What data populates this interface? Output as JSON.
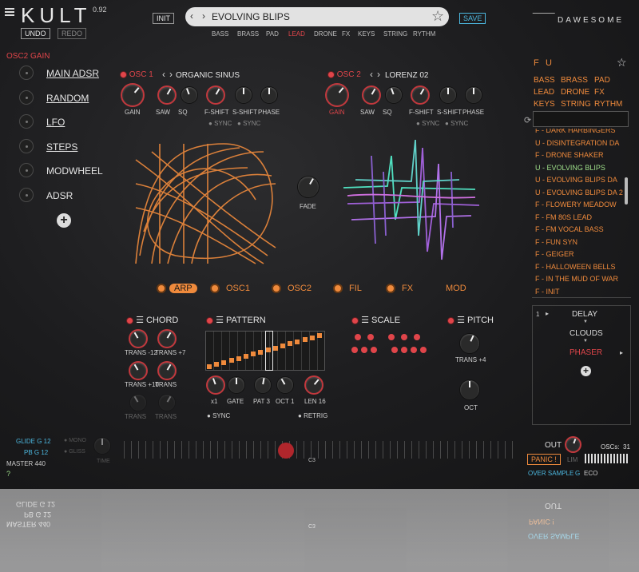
{
  "header": {
    "logo": "KULT",
    "version": "0.92",
    "undo": "UNDO",
    "redo": "REDO",
    "init": "INIT",
    "preset_name": "EVOLVING BLIPS",
    "save": "SAVE",
    "brand": "DAWESOME",
    "categories": [
      "BASS",
      "BRASS",
      "PAD",
      "LEAD",
      "DRONE",
      "FX",
      "KEYS",
      "STRING",
      "RYTHM"
    ],
    "active_category": "LEAD"
  },
  "left": {
    "heading": "OSC2 GAIN",
    "mod_sources": [
      "MAIN ADSR",
      "RANDOM",
      "LFO",
      "STEPS",
      "MODWHEEL",
      "ADSR"
    ]
  },
  "osc1": {
    "label": "OSC 1",
    "wave": "ORGANIC SINUS",
    "knobs": [
      "GAIN",
      "SAW",
      "SQ",
      "F-SHIFT",
      "S-SHIFT",
      "PHASE"
    ],
    "sync": "SYNC"
  },
  "osc2": {
    "label": "OSC 2",
    "wave": "LORENZ 02",
    "knobs": [
      "GAIN",
      "SAW",
      "SQ",
      "F-SHIFT",
      "S-SHIFT",
      "PHASE"
    ],
    "sync": "SYNC"
  },
  "fade_label": "FADE",
  "tabs": [
    "ARP",
    "OSC1",
    "OSC2",
    "FIL",
    "FX",
    "MOD"
  ],
  "active_tab": "ARP",
  "chord": {
    "title": "CHORD",
    "knobs": [
      "TRANS -12",
      "TRANS +7",
      "TRANS +10",
      "TRANS",
      "TRANS",
      "TRANS"
    ]
  },
  "pattern": {
    "title": "PATTERN",
    "knobs": [
      "x1",
      "GATE",
      "PAT 3",
      "OCT 1",
      "LEN 16"
    ],
    "sync": "SYNC",
    "retrig": "RETRIG"
  },
  "scale": {
    "title": "SCALE"
  },
  "pitch": {
    "title": "PITCH",
    "trans": "TRANS +4",
    "oct": "OCT"
  },
  "browser": {
    "filters": [
      "F",
      "U"
    ],
    "categories": [
      "BASS",
      "BRASS",
      "PAD",
      "LEAD",
      "DRONE",
      "FX",
      "KEYS",
      "STRING",
      "RYTHM"
    ],
    "presets": [
      "F - DARK HARBINGERS",
      "U - DISINTEGRATION DA",
      "F - DRONE SHAKER",
      "U - EVOLVING BLIPS",
      "U - EVOLVING BLIPS DA",
      "U - EVOLVING BLIPS DA 2",
      "F - FLOWERY MEADOW",
      "F - FM 80S LEAD",
      "F - FM VOCAL BASS",
      "F - FUN SYN",
      "F - GEIGER",
      "F - HALLOWEEN BELLS",
      "F - IN THE MUD OF WAR",
      "F - INIT"
    ],
    "selected_preset": "U - EVOLVING BLIPS"
  },
  "fx_chain": {
    "slot": "1",
    "items": [
      "DELAY",
      "CLOUDS",
      "PHASER"
    ],
    "active": "PHASER"
  },
  "footer": {
    "glide": "GLIDE G 12",
    "pb": "PB G 12",
    "master": "MASTER 440",
    "mono": "MONO",
    "gliss": "GLISS",
    "time": "TIME",
    "help": "?",
    "note": "C3",
    "out": "OUT",
    "oscs": "OSCs:",
    "oscs_count": "31",
    "panic": "PANIC !",
    "lim": "LIM",
    "oversample": "OVER SAMPLE",
    "oversample_val": "G",
    "eco": "ECO"
  },
  "colors": {
    "accent": "#ef8a3c",
    "red": "#e0454a",
    "cyan": "#4cb8e0",
    "purple": "#a060d8",
    "teal": "#50e0c0"
  }
}
